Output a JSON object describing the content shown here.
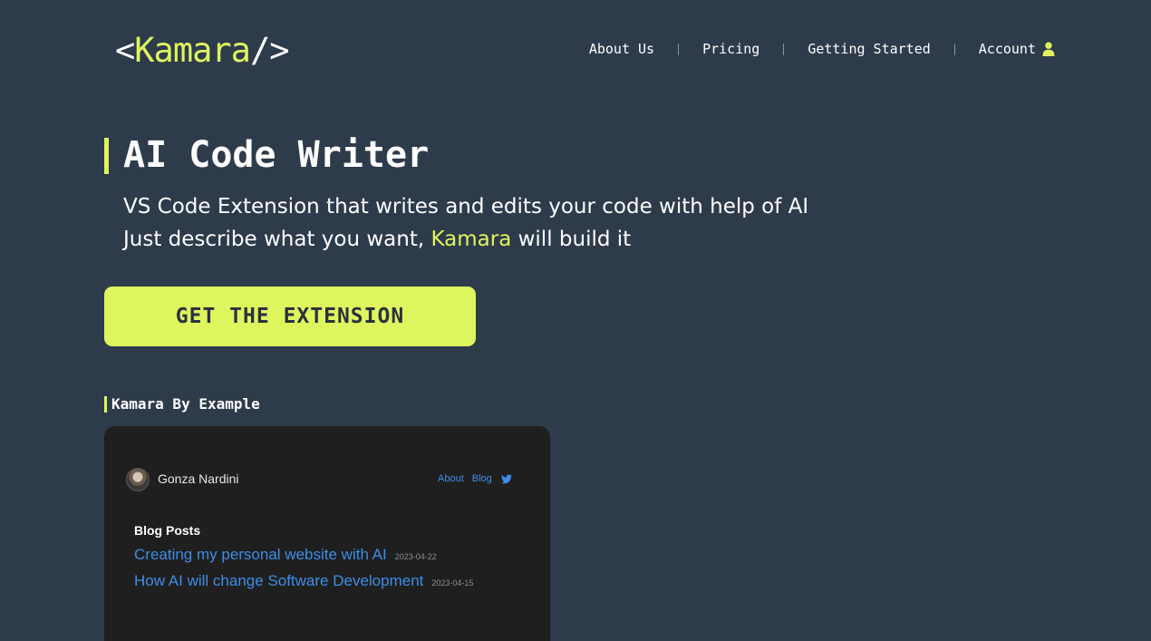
{
  "header": {
    "logo": {
      "open": "<",
      "name": "Kamara",
      "close": "/>"
    },
    "nav": [
      {
        "label": "About Us"
      },
      {
        "label": "Pricing"
      },
      {
        "label": "Getting Started"
      },
      {
        "label": "Account",
        "icon": "user-icon"
      }
    ]
  },
  "hero": {
    "title": "AI Code Writer",
    "line1": "VS Code Extension that writes and edits your code with help of AI",
    "line2_pre": "Just describe what you want, ",
    "line2_accent": "Kamara",
    "line2_post": " will build it",
    "cta": "GET THE EXTENSION"
  },
  "example": {
    "section_title": "Kamara By Example",
    "card": {
      "author": "Gonza Nardini",
      "nav": [
        "About",
        "Blog"
      ],
      "nav_icon": "twitter-icon",
      "posts_title": "Blog Posts",
      "posts": [
        {
          "title": "Creating my personal website with AI",
          "date": "2023-04-22"
        },
        {
          "title": "How AI will change Software Development",
          "date": "2023-04-15"
        }
      ]
    }
  },
  "colors": {
    "background": "#2e3b4b",
    "accent": "#dff55e",
    "card_bg": "#1f1f20",
    "link_blue": "#3d8ee6"
  }
}
